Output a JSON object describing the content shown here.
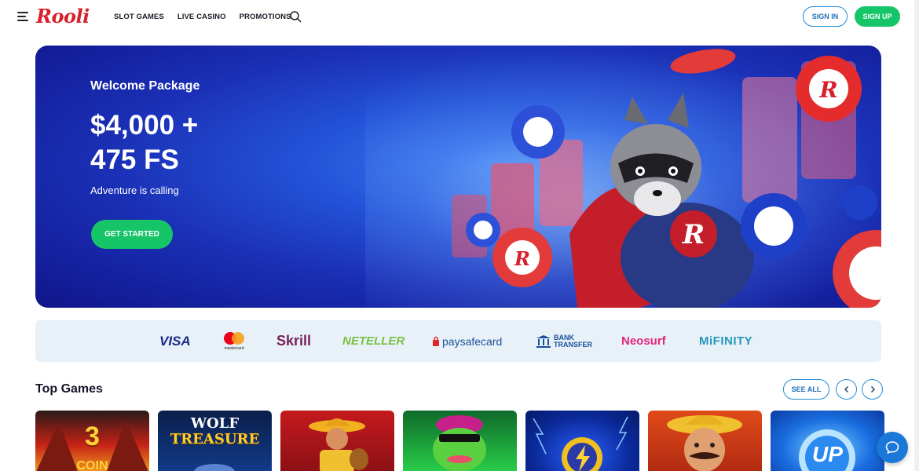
{
  "header": {
    "logo": "Rooli",
    "nav": [
      "SLOT GAMES",
      "LIVE CASINO",
      "PROMOTIONS"
    ],
    "sign_in": "SIGN IN",
    "sign_up": "SIGN UP"
  },
  "hero": {
    "subtitle": "Welcome Package",
    "title_line1": "$4,000 +",
    "title_line2": "475 FS",
    "tagline": "Adventure is calling",
    "cta": "GET STARTED"
  },
  "payments": {
    "visa": "VISA",
    "mastercard": "mastercard",
    "skrill": "Skrill",
    "neteller": "NETELLER",
    "paysafecard": "paysafecard",
    "bank_line1": "BANK",
    "bank_line2": "TRANSFER",
    "neosurf": "Neosurf",
    "mifinity": "MiFINITY"
  },
  "top_games": {
    "title": "Top Games",
    "see_all": "SEE ALL",
    "games": [
      {
        "title": "3",
        "subtitle": "COIN",
        "bg": "#c62216"
      },
      {
        "title": "WOLF",
        "subtitle": "TREASURE",
        "bg": "#0e2c6a"
      },
      {
        "title": "",
        "subtitle": "",
        "bg": "#b5191d"
      },
      {
        "title": "",
        "subtitle": "",
        "bg": "#1e9a3a"
      },
      {
        "title": "",
        "subtitle": "",
        "bg": "#0b2a9a"
      },
      {
        "title": "",
        "subtitle": "",
        "bg": "#d0361a"
      },
      {
        "title": "UP",
        "subtitle": "",
        "bg": "#1a6ee0"
      }
    ]
  },
  "colors": {
    "brand_red": "#d8202c",
    "accent_green": "#15c568",
    "accent_blue": "#1e8ad6"
  }
}
